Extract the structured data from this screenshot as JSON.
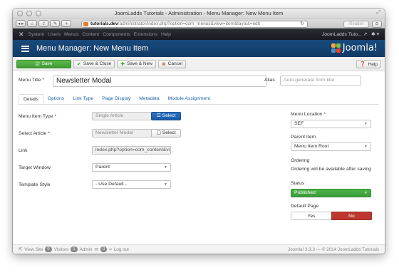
{
  "window": {
    "title": "JoomLadds Tutorials - Administration - Menu Manager: New Menu Item"
  },
  "browser": {
    "url_host": "tutorials.dev",
    "url_path": "/administrator/index.php?option=com_menus&view=item&layout=edit",
    "reader_label": "Reader"
  },
  "adminnav": {
    "items": [
      "System",
      "Users",
      "Menus",
      "Content",
      "Components",
      "Extensions",
      "Help"
    ],
    "site_name": "JoomLadds Tuto...",
    "site_icon": "external-link-icon",
    "user_icon": "gear-icon"
  },
  "header": {
    "title": "Menu Manager: New Menu Item",
    "logo_text": "Joomla!"
  },
  "toolbar": {
    "save": "Save",
    "save_close": "Save & Close",
    "save_new": "Save & New",
    "cancel": "Cancel",
    "help": "Help"
  },
  "form": {
    "menu_title_label": "Menu Title *",
    "menu_title_value": "Newsletter Modal",
    "alias_label": "Alias",
    "alias_placeholder": "Auto-generate from title",
    "tabs": [
      "Details",
      "Options",
      "Link Type",
      "Page Display",
      "Metadata",
      "Module Assignment"
    ],
    "menu_item_type_label": "Menu Item Type *",
    "menu_item_type_value": "Single Article",
    "select_label": "Select",
    "select_article_label": "Select Article *",
    "select_article_value": "Newsletter Modal",
    "link_label": "Link",
    "link_value": "index.php?option=com_content&vi",
    "target_window_label": "Target Window",
    "target_window_value": "Parent",
    "template_style_label": "Template Style",
    "template_style_value": "- Use Default -"
  },
  "sidebar": {
    "menu_location_label": "Menu Location *",
    "menu_location_value": "SEF",
    "parent_item_label": "Parent Item",
    "parent_item_value": "Menu Item Root",
    "ordering_label": "Ordering",
    "ordering_note": "Ordering will be available after saving",
    "status_label": "Status",
    "status_value": "Published",
    "default_page_label": "Default Page",
    "yes": "Yes",
    "no": "No"
  },
  "statusbar": {
    "view_site": "View Site",
    "visitors_count": "0",
    "visitors_label": "Visitors",
    "admin_count": "1",
    "admin_label": "Admin",
    "messages_count": "0",
    "logout": "Log out",
    "right": "Joomla! 3.3.3 — © 2014 JoomLadds Tutorials"
  },
  "colors": {
    "header_blue": "#184a7d",
    "save_green": "#46a83a",
    "select_blue": "#2268b8",
    "no_red": "#bd362f"
  }
}
